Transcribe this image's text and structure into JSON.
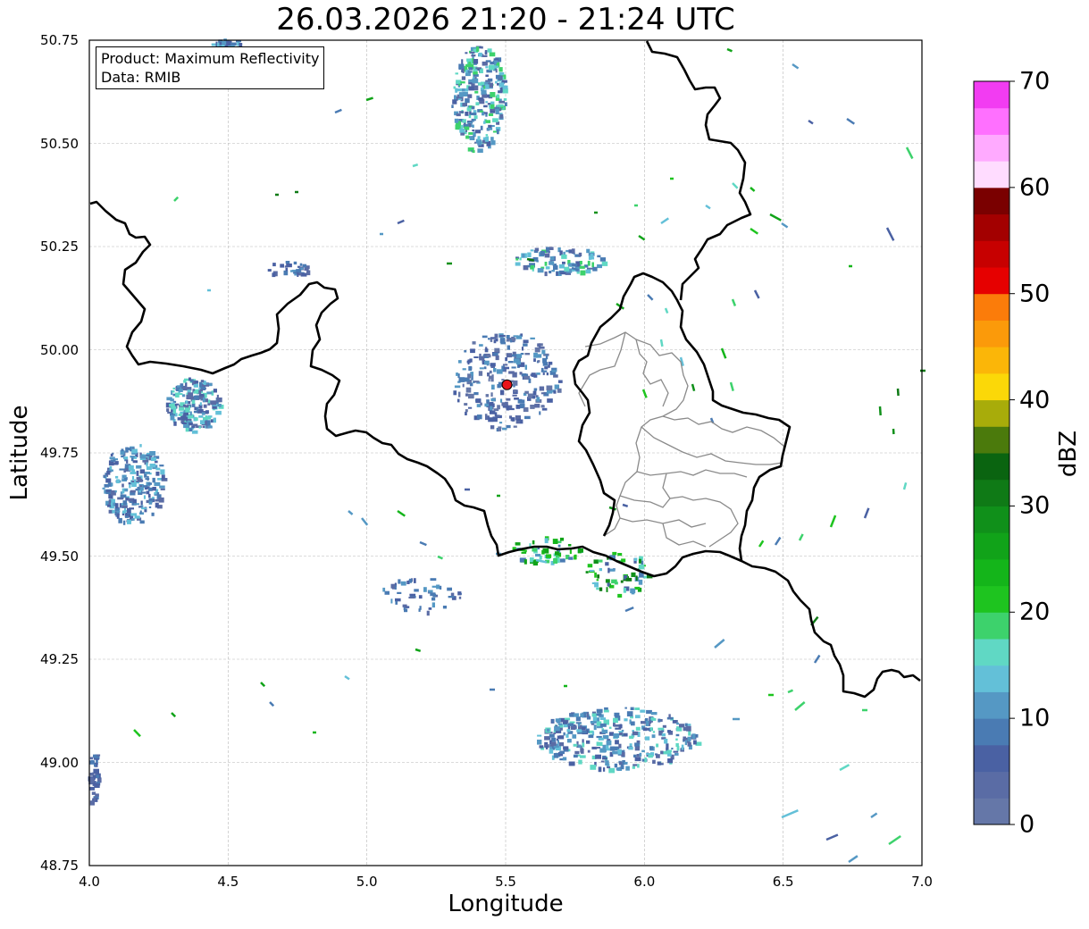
{
  "title": "26.03.2026 21:20 - 21:24 UTC",
  "info_box": {
    "product": "Product: Maximum Reflectivity",
    "data": "Data: RMIB"
  },
  "axes": {
    "xlabel": "Longitude",
    "ylabel": "Latitude",
    "xlim": [
      4.0,
      7.0
    ],
    "ylim": [
      48.75,
      50.75
    ],
    "xticks": [
      "4.0",
      "4.5",
      "5.0",
      "5.5",
      "6.0",
      "6.5",
      "7.0"
    ],
    "yticks": [
      "50.75",
      "50.50",
      "50.25",
      "50.00",
      "49.75",
      "49.50",
      "49.25",
      "49.00",
      "48.75"
    ],
    "grid": true
  },
  "radar_site": {
    "lon": 5.505,
    "lat": 49.915,
    "color": "#e8141a"
  },
  "colorbar": {
    "label": "dBZ",
    "min": 0,
    "max": 70,
    "ticks": [
      "0",
      "10",
      "20",
      "30",
      "40",
      "50",
      "60",
      "70"
    ],
    "colors": [
      "#6577a8",
      "#5a6ca5",
      "#4a61a3",
      "#4a7bb3",
      "#5598c4",
      "#63c0d8",
      "#60d8c4",
      "#3dd26c",
      "#1ec41f",
      "#14b51a",
      "#11a319",
      "#10901a",
      "#0f7a16",
      "#0a6410",
      "#4b7a0c",
      "#a8ac0a",
      "#fbd808",
      "#fbb608",
      "#fb9a0a",
      "#fb7c0a",
      "#e60000",
      "#c70000",
      "#a30000",
      "#7a0000",
      "#ffdcff",
      "#ffaaff",
      "#ff70ff",
      "#f23cf2"
    ]
  }
}
